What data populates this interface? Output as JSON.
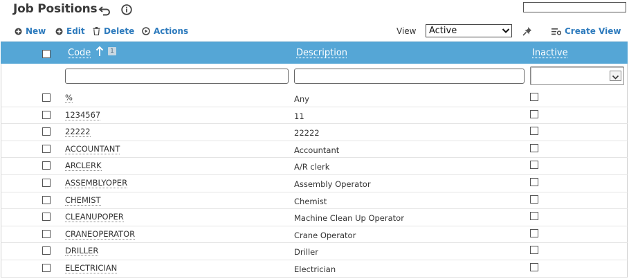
{
  "page": {
    "title": "Job Positions",
    "back_icon": "undo-arrow-icon",
    "info_icon": "info-circle-icon"
  },
  "toolbar": {
    "new_label": "New",
    "edit_label": "Edit",
    "delete_label": "Delete",
    "actions_label": "Actions",
    "view_label": "View",
    "view_value": "Active",
    "create_view_label": "Create View"
  },
  "grid": {
    "columns": {
      "code": "Code",
      "code_sort_rank": "1",
      "description": "Description",
      "inactive": "Inactive"
    },
    "rows": [
      {
        "code": "%",
        "description": "Any"
      },
      {
        "code": "1234567",
        "description": "11"
      },
      {
        "code": "22222",
        "description": "22222"
      },
      {
        "code": "ACCOUNTANT",
        "description": "Accountant"
      },
      {
        "code": "ARCLERK",
        "description": "A/R clerk"
      },
      {
        "code": "ASSEMBLYOPER",
        "description": "Assembly Operator"
      },
      {
        "code": "CHEMIST",
        "description": "Chemist"
      },
      {
        "code": "CLEANUPOPER",
        "description": "Machine Clean Up Operator"
      },
      {
        "code": "CRANEOPERATOR",
        "description": "Crane Operator"
      },
      {
        "code": "DRILLER",
        "description": "Driller"
      },
      {
        "code": "ELECTRICIAN",
        "description": "Electrician"
      }
    ]
  },
  "colors": {
    "header_bg": "#55a6d6",
    "link": "#2e7bbd"
  }
}
